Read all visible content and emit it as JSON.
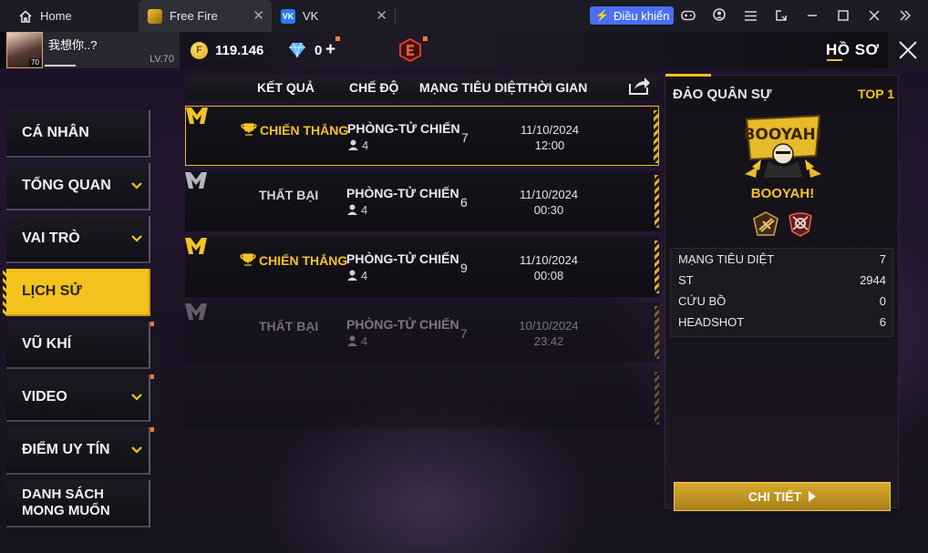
{
  "tabs": {
    "home": "Home",
    "freefire": "Free Fire",
    "vk": "VK"
  },
  "toolbar": {
    "control_label": "Điều khiển"
  },
  "profile": {
    "name": "我想你..?",
    "avatar_level": "70",
    "level": "LV.70"
  },
  "currency": {
    "coins": "119.146",
    "diamonds": "0",
    "plus": "+"
  },
  "header": {
    "title": "HỒ SƠ"
  },
  "nav": [
    {
      "label": "CÁ NHÂN"
    },
    {
      "label": "TỔNG QUAN"
    },
    {
      "label": "VAI TRÒ"
    },
    {
      "label": "LỊCH SỬ"
    },
    {
      "label": "VŨ KHÍ"
    },
    {
      "label": "VIDEO"
    },
    {
      "label": "ĐIỂM UY TÍN"
    },
    {
      "label_line1": "DANH SÁCH",
      "label_line2": "MONG MUỐN"
    }
  ],
  "table": {
    "headers": {
      "result": "KẾT QUẢ",
      "mode": "CHẾ ĐỘ",
      "kills": "MẠNG TIÊU DIỆT",
      "time": "THỜI GIAN"
    },
    "rows": [
      {
        "result": "CHIẾN THẮNG",
        "mode": "PHÒNG-TỬ CHIẾN",
        "players": "4",
        "kills": "7",
        "date": "11/10/2024",
        "time": "12:00"
      },
      {
        "result": "THẤT BẠI",
        "mode": "PHÒNG-TỬ CHIẾN",
        "players": "4",
        "kills": "6",
        "date": "11/10/2024",
        "time": "00:30"
      },
      {
        "result": "CHIẾN THẮNG",
        "mode": "PHÒNG-TỬ CHIẾN",
        "players": "4",
        "kills": "9",
        "date": "11/10/2024",
        "time": "00:08"
      },
      {
        "result": "THẤT BẠI",
        "mode": "PHÒNG-TỬ CHIẾN",
        "players": "4",
        "kills": "7",
        "date": "10/10/2024",
        "time": "23:42"
      }
    ]
  },
  "detail": {
    "map": "ĐẢO QUÂN SỰ",
    "rank": "TOP 1",
    "banner_text": "BOOYAH!",
    "result": "BOOYAH!",
    "stats": [
      {
        "label": "MẠNG TIÊU DIỆT",
        "value": "7"
      },
      {
        "label": "ST",
        "value": "2944"
      },
      {
        "label": "CỨU BỒ",
        "value": "0"
      },
      {
        "label": "HEADSHOT",
        "value": "6"
      }
    ],
    "button": "CHI TIẾT"
  },
  "icons": {
    "home": "home-icon",
    "gamepad": "gamepad-icon",
    "account": "account-icon",
    "menu": "menu-icon",
    "expand": "expand-icon",
    "minimize": "minimize-icon",
    "maximize": "maximize-icon",
    "close": "close-icon",
    "chevrons": "double-chevron-right-icon",
    "share": "share-icon",
    "trophy": "trophy-icon"
  },
  "colors": {
    "accent_gold": "#f4c328",
    "active_nav": "#f5c11c",
    "control_blue": "#4a6ff5",
    "notify_dot": "#ff7a2a"
  }
}
